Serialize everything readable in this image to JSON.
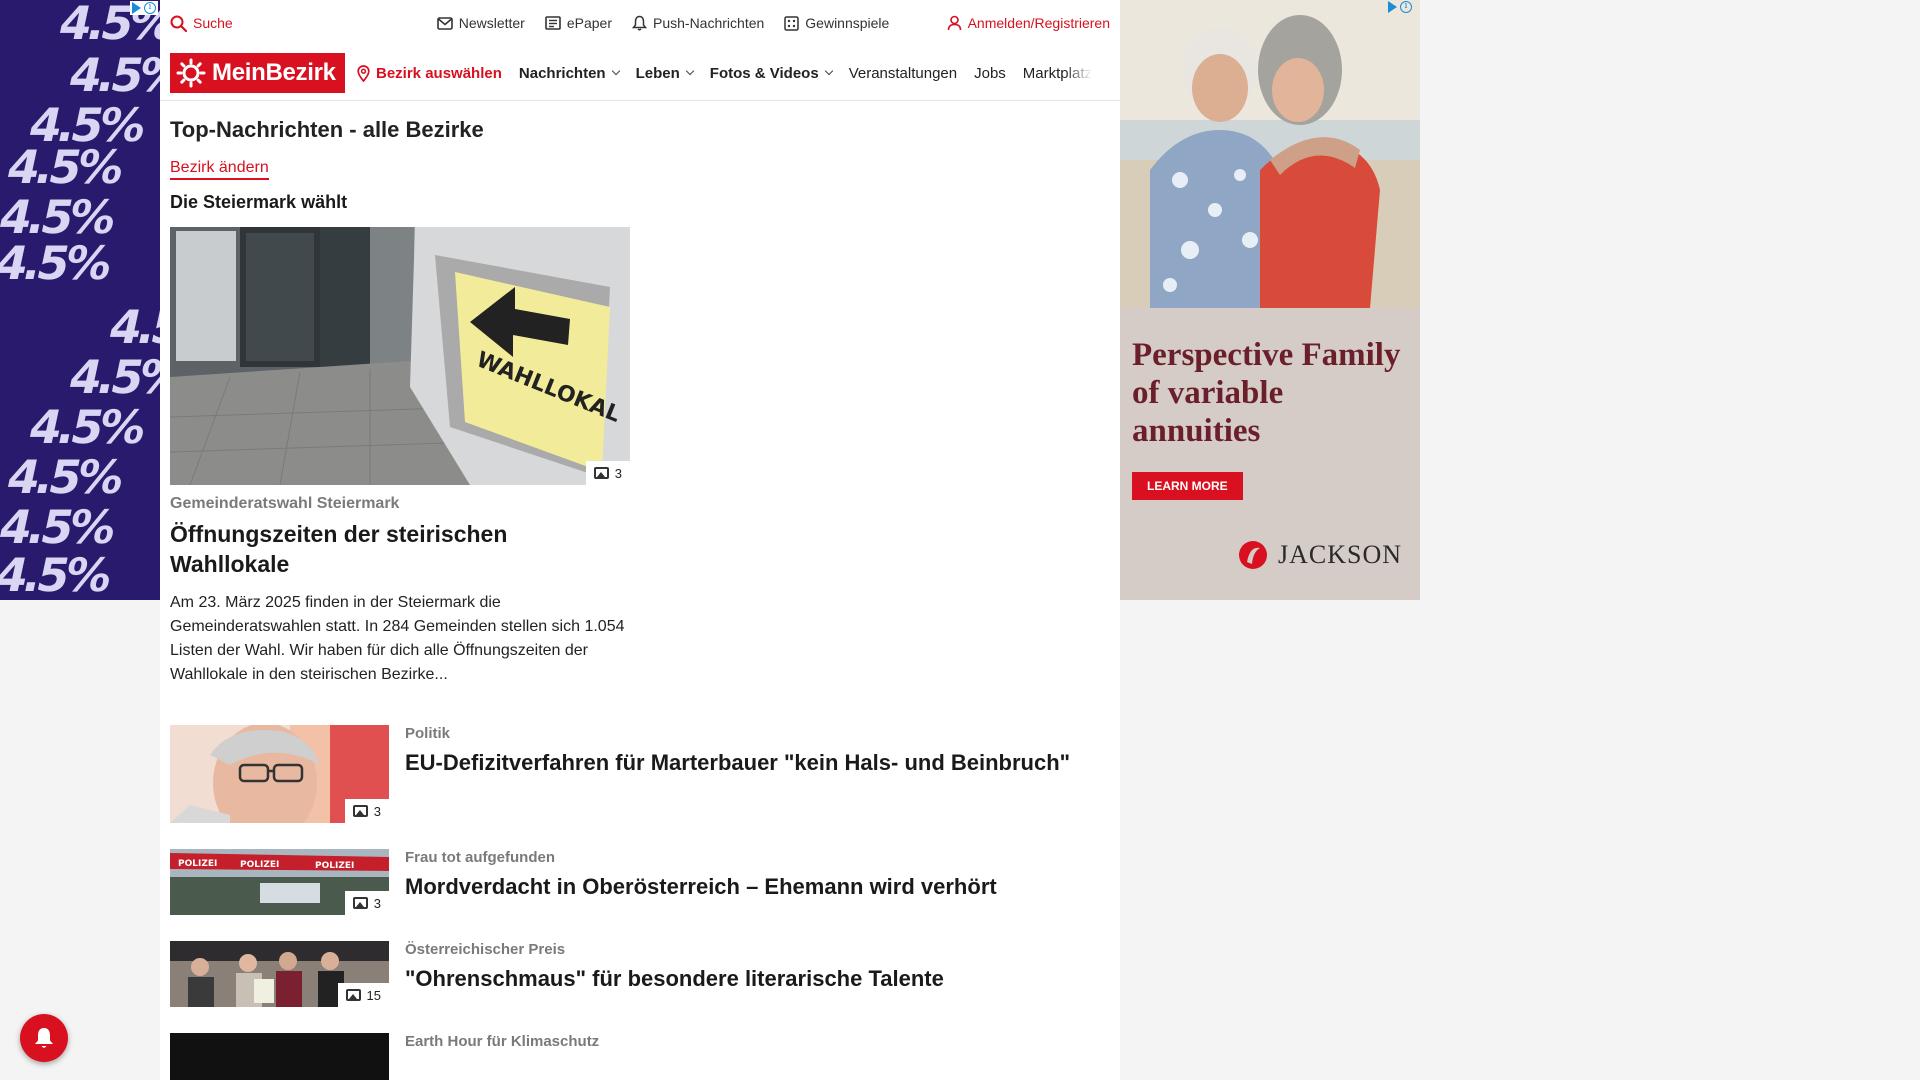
{
  "topbar": {
    "search_label": "Suche",
    "items": [
      {
        "label": "Newsletter",
        "icon": "mail-icon"
      },
      {
        "label": "ePaper",
        "icon": "newspaper-icon"
      },
      {
        "label": "Push-Nachrichten",
        "icon": "bell-icon"
      },
      {
        "label": "Gewinnspiele",
        "icon": "gift-icon"
      }
    ],
    "login_label": "Anmelden/Registrieren"
  },
  "nav": {
    "logo_text": "MeinBezirk",
    "bezirk_label": "Bezirk auswählen",
    "items": [
      "Nachrichten",
      "Leben",
      "Fotos & Videos",
      "Veranstaltungen",
      "Jobs",
      "Marktplatz"
    ]
  },
  "page": {
    "title": "Top-Nachrichten - alle Bezirke",
    "change_link": "Bezirk ändern",
    "section_title": "Die Steiermark wählt"
  },
  "hero": {
    "image_count": "3",
    "sign_text": "WAHLLOKAL",
    "kicker": "Gemeinderatswahl Steiermark",
    "title": "Öffnungszeiten der steirischen Wahllokale",
    "teaser": "Am 23. März 2025 finden in der Steiermark die Gemeinderatswahlen statt. In 284 Gemeinden stellen sich 1.054 Listen der Wahl. Wir haben für dich alle Öffnungszeiten der Wahllokale in den steirischen Bezirke..."
  },
  "articles": [
    {
      "kicker": "Politik",
      "title": "EU-Defizitverfahren für Marterbauer \"kein Hals- und Beinbruch\"",
      "image_count": "3"
    },
    {
      "kicker": "Frau tot aufgefunden",
      "title": "Mordverdacht in Oberösterreich – Ehemann wird verhört",
      "image_count": "3",
      "tape_text": "POLIZEI"
    },
    {
      "kicker": "Österreichischer Preis",
      "title": "\"Ohrenschmaus\" für besondere literarische Talente",
      "image_count": "15"
    },
    {
      "kicker": "Earth Hour für Klimaschutz",
      "title": ""
    }
  ],
  "ad_left": {
    "text": "4.5%"
  },
  "ad_right": {
    "headline": "Perspective Family of variable annuities",
    "button": "LEARN MORE",
    "brand": "JACKSON"
  },
  "colors": {
    "brand_red": "#d8101f",
    "ad_left_bg": "#2a1a6e",
    "ad_right_text": "#6b1f2b"
  }
}
